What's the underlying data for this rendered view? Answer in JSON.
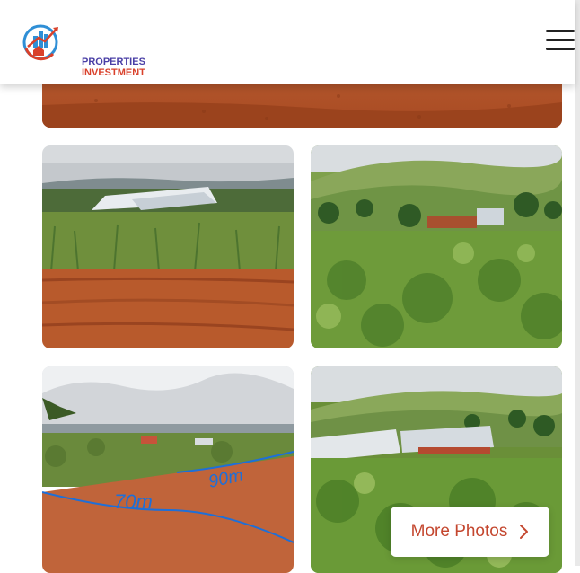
{
  "header": {
    "logo": {
      "line1": "PROPERTIES",
      "line2": "INVESTMENT"
    }
  },
  "gallery": {
    "more_button_label": "More Photos",
    "photo_annotations": {
      "front": "70m",
      "side": "90m"
    }
  },
  "icons": {
    "menu": "hamburger-menu-icon",
    "chevron": "chevron-right-icon"
  },
  "colors": {
    "logo_blue": "#2f8fd6",
    "logo_red": "#d9412b",
    "logo_text": "#4a3fa6",
    "button_text": "#c4472f",
    "soil": "#b5552a"
  }
}
